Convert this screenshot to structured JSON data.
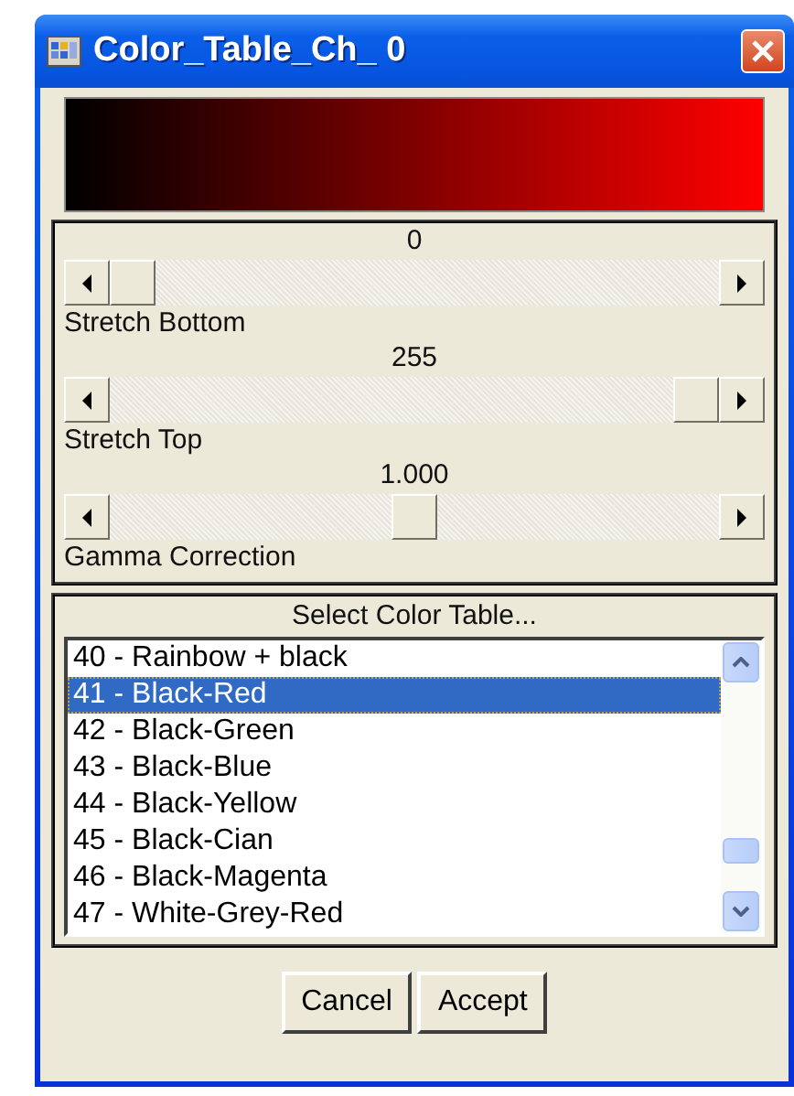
{
  "window": {
    "title": "Color_Table_Ch_ 0"
  },
  "sliders": [
    {
      "value": "0",
      "label": "Stretch Bottom",
      "level": 0
    },
    {
      "value": "255",
      "label": "Stretch Top",
      "level": 1
    },
    {
      "value": "1.000",
      "label": "Gamma Correction",
      "level": 0.5
    }
  ],
  "color_table": {
    "title": "Select Color Table...",
    "items": [
      {
        "label": "40 - Rainbow + black",
        "selected": false
      },
      {
        "label": "41 - Black-Red",
        "selected": true
      },
      {
        "label": "42 - Black-Green",
        "selected": false
      },
      {
        "label": "43 - Black-Blue",
        "selected": false
      },
      {
        "label": "44 - Black-Yellow",
        "selected": false
      },
      {
        "label": "45 - Black-Cian",
        "selected": false
      },
      {
        "label": "46 - Black-Magenta",
        "selected": false
      },
      {
        "label": "47 - White-Grey-Red",
        "selected": false
      }
    ]
  },
  "buttons": [
    "Cancel",
    "Accept"
  ]
}
